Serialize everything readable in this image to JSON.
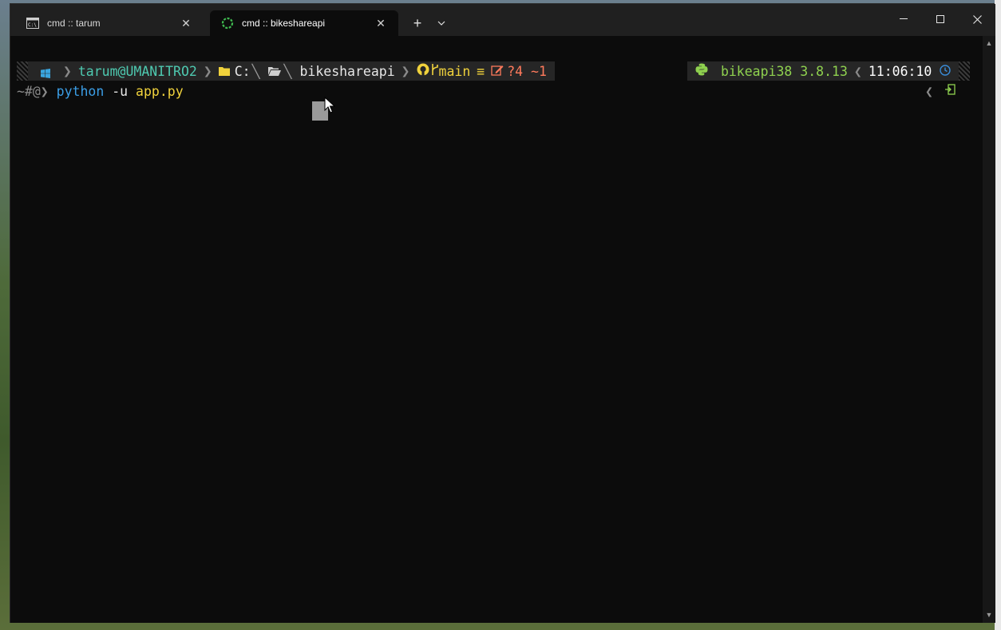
{
  "tabs": [
    {
      "label": "cmd :: tarum",
      "icon": "cmd-icon",
      "close": "✕"
    },
    {
      "label": "cmd :: bikeshareapi",
      "icon": "spinner-icon",
      "close": "✕"
    }
  ],
  "titlebar": {
    "new_tab": "+",
    "dropdown": "⌄",
    "minimize": "—",
    "maximize": "☐",
    "close": "✕"
  },
  "prompt": {
    "user_host": "tarum@UMANITRO2",
    "drive": "C:",
    "directory": "bikeshareapi",
    "git_branch": "main",
    "git_equal": "≡",
    "git_status": "?4 ~1",
    "python_env": "bikeapi38 3.8.13",
    "time": "11:06:10",
    "ps1": "~#@❯ "
  },
  "command": {
    "program": "python",
    "args": " -u",
    "file": " app.py"
  },
  "colors": {
    "accent": "#3b9ee6",
    "user": "#4ec9b0",
    "git": "#f0d23c",
    "status": "#ff7a5c",
    "python": "#8fd14f"
  }
}
